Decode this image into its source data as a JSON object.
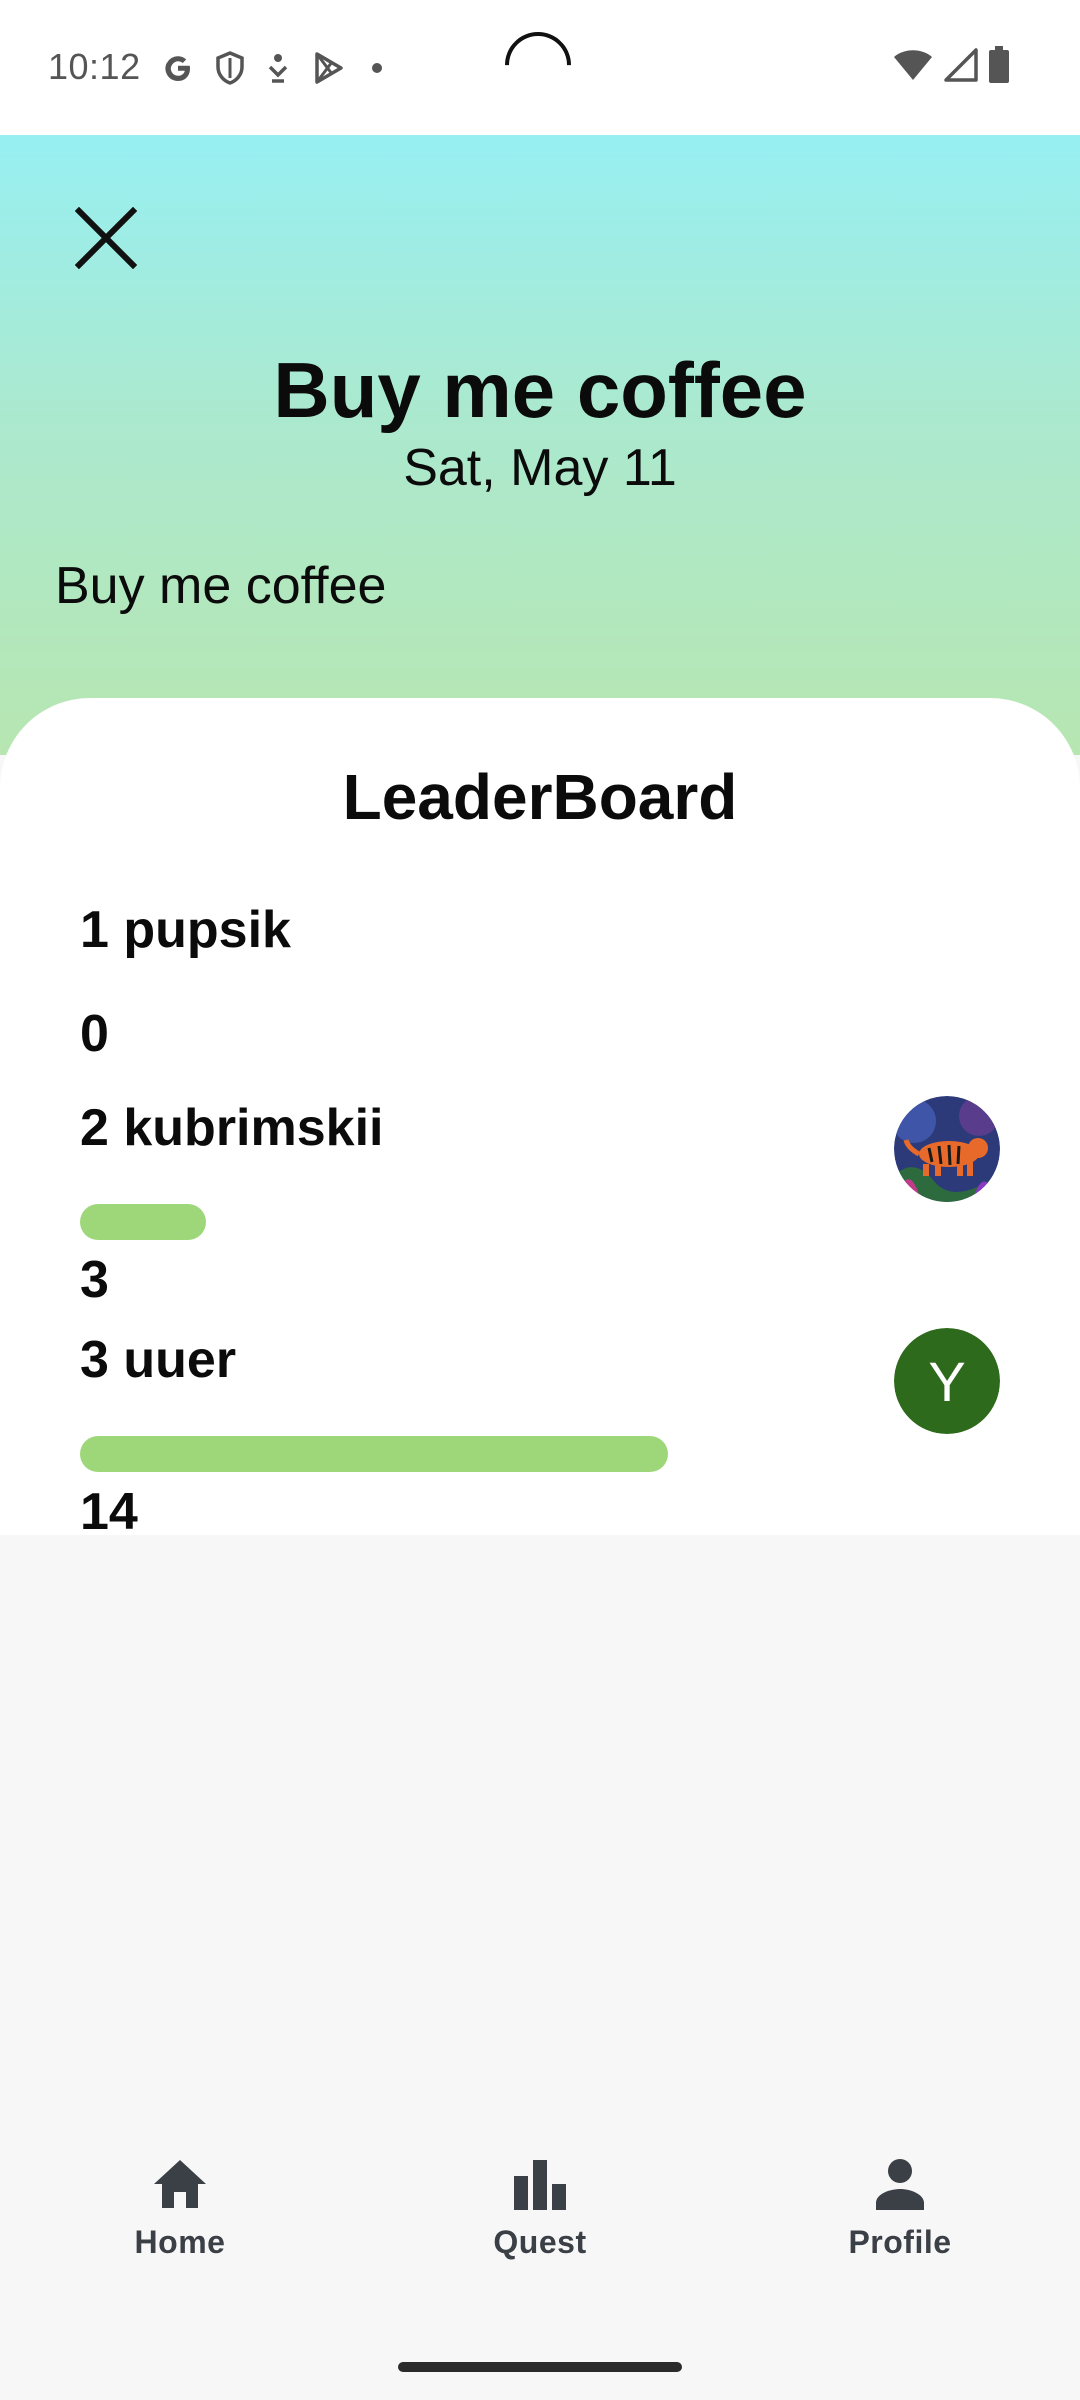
{
  "status_bar": {
    "time": "10:12",
    "icons_left": [
      "google-icon",
      "shield-icon",
      "download-status-icon",
      "play-store-icon",
      "dot-icon"
    ],
    "icons_right": [
      "wifi-icon",
      "signal-icon",
      "battery-icon"
    ]
  },
  "header": {
    "title": "Buy me coffee",
    "date": "Sat, May 11",
    "description": "Buy me coffee",
    "close_icon": "close-icon"
  },
  "leaderboard": {
    "title": "LeaderBoard",
    "entries": [
      {
        "rank_name": "1 pupsik",
        "score": "0",
        "progress": 0,
        "avatar": null
      },
      {
        "rank_name": "2 kubrimskii",
        "score": "3",
        "progress": 0.214,
        "avatar": "tiger-image"
      },
      {
        "rank_name": "3 uuer",
        "score": "14",
        "progress": 1.0,
        "avatar_letter": "Y"
      }
    ],
    "bar_color": "#9ed67a"
  },
  "bottom_nav": {
    "items": [
      {
        "label": "Home",
        "icon": "home-icon"
      },
      {
        "label": "Quest",
        "icon": "bar-chart-icon"
      },
      {
        "label": "Profile",
        "icon": "person-icon"
      }
    ]
  },
  "colors": {
    "gradient_top": "#97eff2",
    "gradient_bottom": "#b7e6b1",
    "avatar_bg": "#2d6a1c"
  }
}
